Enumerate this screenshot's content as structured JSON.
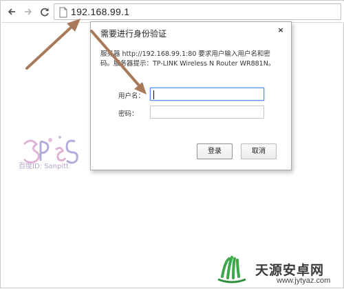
{
  "browser": {
    "url": "192.168.99.1",
    "back_icon": "back-arrow-icon",
    "forward_icon": "forward-arrow-icon",
    "reload_icon": "reload-icon",
    "page_icon": "page-icon"
  },
  "dialog": {
    "title": "需要进行身份验证",
    "close_label": "×",
    "message_line1": "服务器 http://192.168.99.1:80 要求用户输入用户名和密",
    "message_line2": "码。服务器提示：TP-LINK Wireless N Router WR881N。",
    "username_label": "用户名：",
    "username_value": "",
    "password_label": "密码：",
    "password_value": "",
    "login_button": "登录",
    "cancel_button": "取消"
  },
  "watermark": {
    "text": "百度ID: Sanpitt"
  },
  "branding": {
    "site_name": "天源安卓网",
    "site_url": "www.jytyaz.com"
  },
  "colors": {
    "annotation_arrow": "#a87a5a",
    "focus_border": "#4d90fe"
  }
}
